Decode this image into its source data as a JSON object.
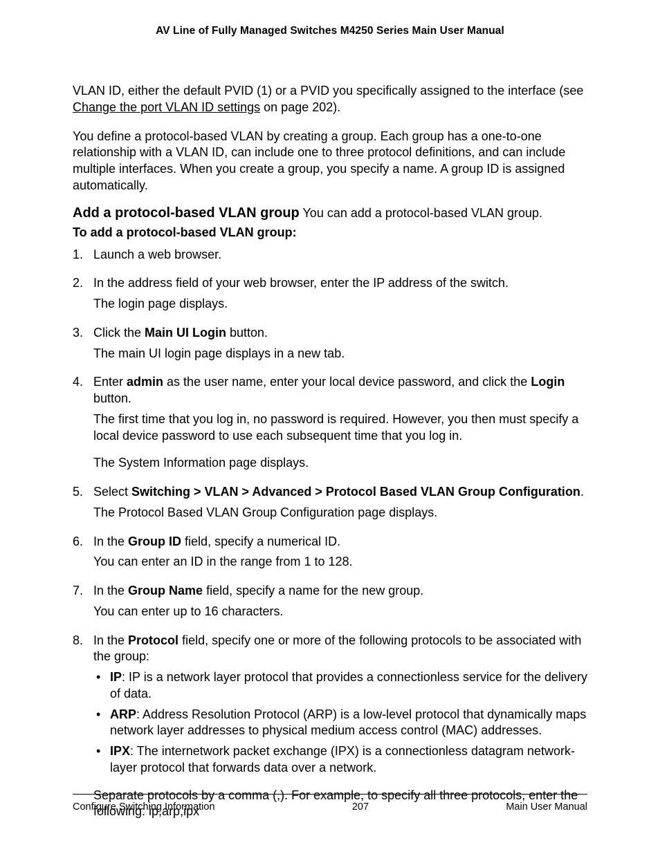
{
  "header": {
    "title": "AV Line of Fully Managed Switches M4250 Series Main User Manual"
  },
  "intro": {
    "p1_a": "VLAN ID, either the default PVID (1) or a PVID you specifically assigned to the interface (see ",
    "p1_link": "Change the port VLAN ID settings",
    "p1_b": " on page 202).",
    "p2": "You define a protocol-based VLAN by creating a group. Each group has a one-to-one relationship with a VLAN ID, can include one to three protocol definitions, and can include multiple interfaces. When you create a group, you specify a name. A group ID is assigned automatically."
  },
  "heading": {
    "main": "Add a protocol-based VLAN group",
    "tail": " You can add a protocol-based VLAN group.",
    "sub": "To add a protocol-based VLAN group:"
  },
  "steps": {
    "s1": "Launch a web browser.",
    "s2": {
      "line1": "In the address field of your web browser, enter the IP address of the switch.",
      "line2": "The login page displays."
    },
    "s3": {
      "a": "Click the ",
      "b": "Main UI Login",
      "c": " button.",
      "line2": "The main UI login page displays in a new tab."
    },
    "s4": {
      "a": "Enter ",
      "b": "admin",
      "c": " as the user name, enter your local device password, and click the ",
      "d": "Login",
      "e": " button.",
      "line2": "The first time that you log in, no password is required. However, you then must specify a local device password to use each subsequent time that you log in.",
      "line3": "The System Information page displays."
    },
    "s5": {
      "a": "Select ",
      "b": "Switching > VLAN > Advanced > Protocol Based VLAN Group Configuration",
      "c": ".",
      "line2": "The Protocol Based VLAN Group Configuration page displays."
    },
    "s6": {
      "a": "In the ",
      "b": "Group ID",
      "c": " field, specify a numerical ID.",
      "line2": "You can enter an ID in the range from 1 to 128."
    },
    "s7": {
      "a": "In the ",
      "b": "Group Name",
      "c": " field, specify a name for the new group.",
      "line2": "You can enter up to 16 characters."
    },
    "s8": {
      "a": "In the ",
      "b": "Protocol",
      "c": " field, specify one or more of the following protocols to be associated with the group:",
      "bullets": {
        "ip": {
          "label": "IP",
          "text": ": IP is a network layer protocol that provides a connectionless service for the delivery of data."
        },
        "arp": {
          "label": "ARP",
          "text": ": Address Resolution Protocol (ARP) is a low-level protocol that dynamically maps network layer addresses to physical medium access control (MAC) addresses."
        },
        "ipx": {
          "label": "IPX",
          "text": ": The internetwork packet exchange (IPX) is a connectionless datagram network-layer protocol that forwards data over a network."
        }
      },
      "tail": "Separate protocols by a comma (,). For example, to specify all three protocols, enter the following: ip,arp,ipx"
    }
  },
  "footer": {
    "left": "Configure Switching Information",
    "center": "207",
    "right": "Main User Manual"
  }
}
